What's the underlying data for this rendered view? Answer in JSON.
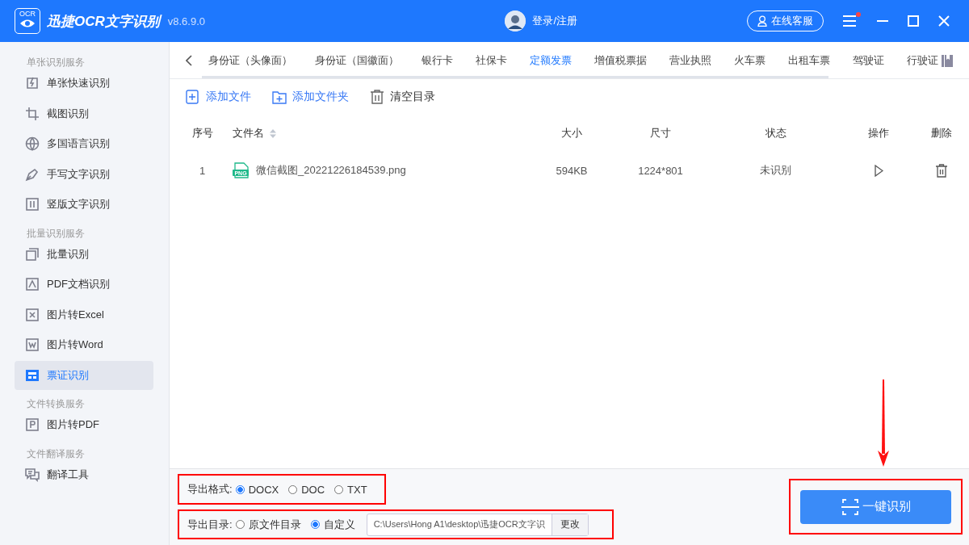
{
  "titlebar": {
    "logo_text": "OCR",
    "app_name": "迅捷OCR文字识别",
    "version": "v8.6.9.0",
    "login": "登录/注册",
    "service_button": "在线客服",
    "has_notification": true
  },
  "sidebar": {
    "groups": [
      {
        "title": "单张识别服务",
        "items": [
          {
            "label": "单张快速识别",
            "selected": false
          },
          {
            "label": "截图识别",
            "selected": false
          },
          {
            "label": "多国语言识别",
            "selected": false
          },
          {
            "label": "手写文字识别",
            "selected": false
          },
          {
            "label": "竖版文字识别",
            "selected": false
          }
        ]
      },
      {
        "title": "批量识别服务",
        "items": [
          {
            "label": "批量识别",
            "selected": false
          },
          {
            "label": "PDF文档识别",
            "selected": false
          },
          {
            "label": "图片转Excel",
            "selected": false
          },
          {
            "label": "图片转Word",
            "selected": false
          },
          {
            "label": "票证识别",
            "selected": true
          }
        ]
      },
      {
        "title": "文件转换服务",
        "items": [
          {
            "label": "图片转PDF",
            "selected": false
          }
        ]
      },
      {
        "title": "文件翻译服务",
        "items": [
          {
            "label": "翻译工具",
            "selected": false
          }
        ]
      }
    ]
  },
  "tabs": [
    {
      "label": "身份证（头像面）",
      "selected": false
    },
    {
      "label": "身份证（国徽面）",
      "selected": false
    },
    {
      "label": "银行卡",
      "selected": false
    },
    {
      "label": "社保卡",
      "selected": false
    },
    {
      "label": "定额发票",
      "selected": true
    },
    {
      "label": "增值税票据",
      "selected": false
    },
    {
      "label": "营业执照",
      "selected": false
    },
    {
      "label": "火车票",
      "selected": false
    },
    {
      "label": "出租车票",
      "selected": false
    },
    {
      "label": "驾驶证",
      "selected": false
    },
    {
      "label": "行驶证",
      "selected": false
    }
  ],
  "toolbar": [
    {
      "kind": "add-file",
      "label": "添加文件"
    },
    {
      "kind": "add-folder",
      "label": "添加文件夹"
    },
    {
      "kind": "clear",
      "label": "清空目录"
    }
  ],
  "table": {
    "columns": [
      "序号",
      "文件名",
      "大小",
      "尺寸",
      "状态",
      "操作",
      "删除"
    ],
    "rows": [
      {
        "index": "1",
        "file_type": "PNG",
        "file_name": "微信截图_20221226184539.png",
        "size": "594KB",
        "dimensions": "1224*801",
        "status": "未识别"
      }
    ]
  },
  "export": {
    "format_label": "导出格式:",
    "formats": [
      {
        "label": "DOCX",
        "selected": true
      },
      {
        "label": "DOC",
        "selected": false
      },
      {
        "label": "TXT",
        "selected": false
      }
    ],
    "dir_label": "导出目录:",
    "dirs": [
      {
        "label": "原文件目录",
        "selected": false
      },
      {
        "label": "自定义",
        "selected": true
      }
    ],
    "path": "C:\\Users\\Hong A1\\desktop\\迅捷OCR文字识",
    "change_button": "更改"
  },
  "recognize_button": "一键识别"
}
